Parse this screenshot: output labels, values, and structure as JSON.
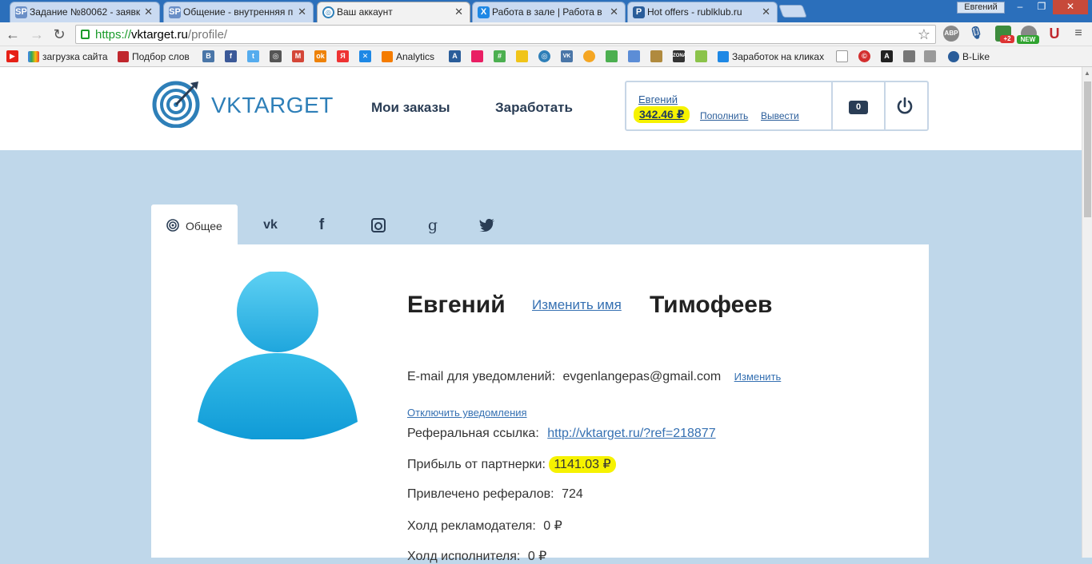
{
  "browser": {
    "tabs": [
      {
        "title": "Задание №80062 - заявк",
        "favicon": "SP"
      },
      {
        "title": "Общение - внутренняя п",
        "favicon": "SP"
      },
      {
        "title": "Ваш аккаунт",
        "favicon": "target"
      },
      {
        "title": "Работа в зале | Работа в",
        "favicon": "X"
      },
      {
        "title": "Hot offers - rublklub.ru",
        "favicon": "P"
      }
    ],
    "active_tab": 2,
    "profile_name": "Евгений",
    "url_scheme": "https://",
    "url_host": "vktarget.ru",
    "url_path": "/profile/",
    "extensions": [
      "ABP",
      "+2",
      "NEW",
      "U"
    ]
  },
  "bookmarks": [
    "загрузка сайта",
    "Подбор слов",
    "Analytics",
    "Заработок на кликах",
    "B-Like"
  ],
  "site": {
    "logo_text": "VKTARGET",
    "nav": {
      "orders": "Мои заказы",
      "earn": "Заработать"
    },
    "account": {
      "name": "Евгений",
      "balance": "342.46 ₽",
      "topup": "Пополнить",
      "withdraw": "Вывести",
      "messages_count": "0"
    }
  },
  "profile_tabs": {
    "general": "Общее"
  },
  "profile": {
    "first_name": "Евгений",
    "last_name": "Тимофеев",
    "edit_name": "Изменить имя",
    "email_label": "E-mail для уведомлений:",
    "email": "evgenlangepas@gmail.com",
    "email_change": "Изменить",
    "disable_notifications": "Отключить уведомления",
    "ref_label": "Реферальная ссылка:",
    "ref_link": "http://vktarget.ru/?ref=218877",
    "partner_label": "Прибыль от партнерки:",
    "partner_value": "1141.03 ₽",
    "referrals_label": "Привлечено рефералов:",
    "referrals_value": "724",
    "adv_hold_label": "Холд рекламодателя:",
    "adv_hold_value": "0 ₽",
    "exec_hold_label": "Холд исполнителя:",
    "exec_hold_value": "0 ₽"
  },
  "colors": {
    "accent": "#2e7fb8",
    "page_bg": "#bfd7ea",
    "highlight": "#f6f200",
    "nav_text": "#2a3d55"
  }
}
